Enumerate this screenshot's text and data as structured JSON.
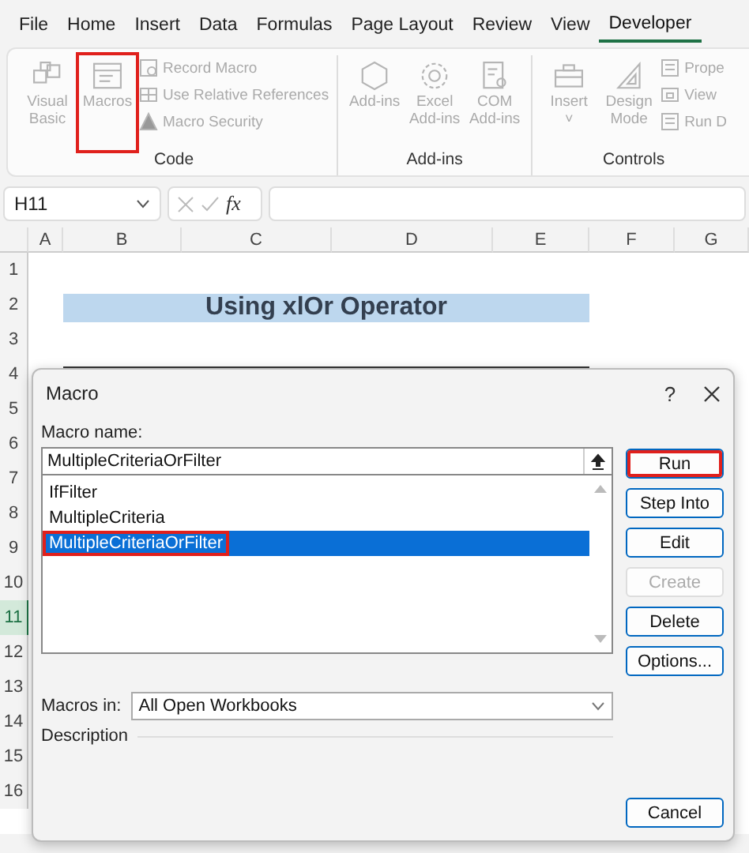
{
  "menu_tabs": [
    {
      "label": "File",
      "selected": false
    },
    {
      "label": "Home",
      "selected": false
    },
    {
      "label": "Insert",
      "selected": false
    },
    {
      "label": "Data",
      "selected": false
    },
    {
      "label": "Formulas",
      "selected": false
    },
    {
      "label": "Page Layout",
      "selected": false
    },
    {
      "label": "Review",
      "selected": false
    },
    {
      "label": "View",
      "selected": false
    },
    {
      "label": "Developer",
      "selected": true
    }
  ],
  "ribbon": {
    "groups": [
      {
        "label": "Code",
        "items": [
          {
            "kind": "large",
            "label": "Visual Basic",
            "highlighted": false
          },
          {
            "kind": "large",
            "label": "Macros",
            "highlighted": true
          },
          {
            "kind": "stack",
            "entries": [
              {
                "label": "Record Macro"
              },
              {
                "label": "Use Relative References"
              },
              {
                "label": "Macro Security"
              }
            ]
          }
        ]
      },
      {
        "label": "Add-ins",
        "items": [
          {
            "kind": "large",
            "label": "Add-ins",
            "highlighted": false
          },
          {
            "kind": "large",
            "label": "Excel Add-ins",
            "highlighted": false
          },
          {
            "kind": "large",
            "label": "COM Add-ins",
            "highlighted": false
          }
        ]
      },
      {
        "label": "Controls",
        "items": [
          {
            "kind": "large",
            "label": "Insert",
            "caret": "˅",
            "highlighted": false
          },
          {
            "kind": "large",
            "label": "Design Mode",
            "highlighted": false
          },
          {
            "kind": "stack",
            "entries": [
              {
                "label": "Prope"
              },
              {
                "label": "View"
              },
              {
                "label": "Run D"
              }
            ]
          }
        ]
      }
    ]
  },
  "formula_bar": {
    "name_box": "H11",
    "fx": "fx"
  },
  "columns": [
    "A",
    "B",
    "C",
    "D",
    "E",
    "F",
    "G"
  ],
  "rows": [
    {
      "label": "1",
      "selected": false
    },
    {
      "label": "2",
      "selected": false
    },
    {
      "label": "3",
      "selected": false
    },
    {
      "label": "4",
      "selected": false
    },
    {
      "label": "5",
      "selected": false
    },
    {
      "label": "6",
      "selected": false
    },
    {
      "label": "7",
      "selected": false
    },
    {
      "label": "8",
      "selected": false
    },
    {
      "label": "9",
      "selected": false
    },
    {
      "label": "10",
      "selected": false
    },
    {
      "label": "11",
      "selected": true
    },
    {
      "label": "12",
      "selected": false
    },
    {
      "label": "13",
      "selected": false
    },
    {
      "label": "14",
      "selected": false
    },
    {
      "label": "15",
      "selected": false
    },
    {
      "label": "16",
      "selected": false
    }
  ],
  "sheet_title": "Using xlOr Operator",
  "dialog": {
    "title": "Macro",
    "help": "?",
    "macro_name_label": "Macro name:",
    "macro_name_value": "MultipleCriteriaOrFilter",
    "macros": [
      {
        "name": "IfFilter",
        "selected": false,
        "highlighted": false
      },
      {
        "name": "MultipleCriteria",
        "selected": false,
        "highlighted": false
      },
      {
        "name": "MultipleCriteriaOrFilter",
        "selected": true,
        "highlighted": true
      }
    ],
    "buttons": [
      {
        "label": "Run",
        "disabled": false,
        "highlighted": true
      },
      {
        "label": "Step Into",
        "disabled": false,
        "highlighted": false
      },
      {
        "label": "Edit",
        "disabled": false,
        "highlighted": false
      },
      {
        "label": "Create",
        "disabled": true,
        "highlighted": false
      },
      {
        "label": "Delete",
        "disabled": false,
        "highlighted": false
      },
      {
        "label": "Options...",
        "disabled": false,
        "highlighted": false
      }
    ],
    "macros_in_label": "Macros in:",
    "macros_in_value": "All Open Workbooks",
    "description_label": "Description",
    "cancel": "Cancel"
  }
}
